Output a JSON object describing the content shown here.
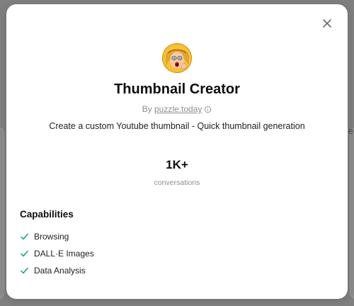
{
  "gpt": {
    "name": "Thumbnail Creator",
    "by_prefix": "By",
    "author": "puzzle.today",
    "description": "Create a custom Youtube thumbnail - Quick thumbnail generation",
    "avatar_icon": "pop-art-woman-avatar"
  },
  "stats": {
    "value": "1K+",
    "label": "conversations"
  },
  "capabilities": {
    "title": "Capabilities",
    "items": [
      {
        "label": "Browsing"
      },
      {
        "label": "DALL·E Images"
      },
      {
        "label": "Data Analysis"
      }
    ]
  },
  "icons": {
    "close": "close-icon",
    "info": "info-icon",
    "check": "check-icon"
  },
  "colors": {
    "check": "#10a37f",
    "overlay": "#7f7f7f"
  }
}
